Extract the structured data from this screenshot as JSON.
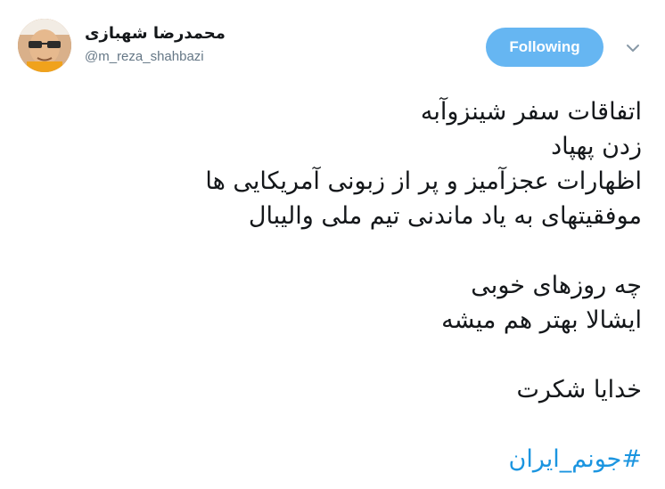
{
  "author": {
    "display_name": "محمدرضا شهبازی",
    "handle": "@m_reza_shahbazi"
  },
  "follow_button": {
    "label": "Following"
  },
  "tweet": {
    "lines_block1": [
      "اتفاقات سفر شینزوآبه",
      "زدن پهپاد",
      "اظهارات عجزآمیز و پر از زبونی آمریکایی ها",
      "موفقیتهای به یاد ماندنی تیم ملی والیبال"
    ],
    "lines_block2": [
      "چه روزهای خوبی",
      "ایشالا بهتر هم میشه"
    ],
    "lines_block3": [
      "خدایا شکرت"
    ],
    "hashtag": "#جونم_ایران"
  },
  "colors": {
    "follow_bg": "#66b6f2",
    "hashtag": "#1b95e0",
    "handle": "#657786",
    "text": "#14171a"
  },
  "icons": {
    "caret": "chevron-down-icon",
    "avatar": "avatar"
  }
}
